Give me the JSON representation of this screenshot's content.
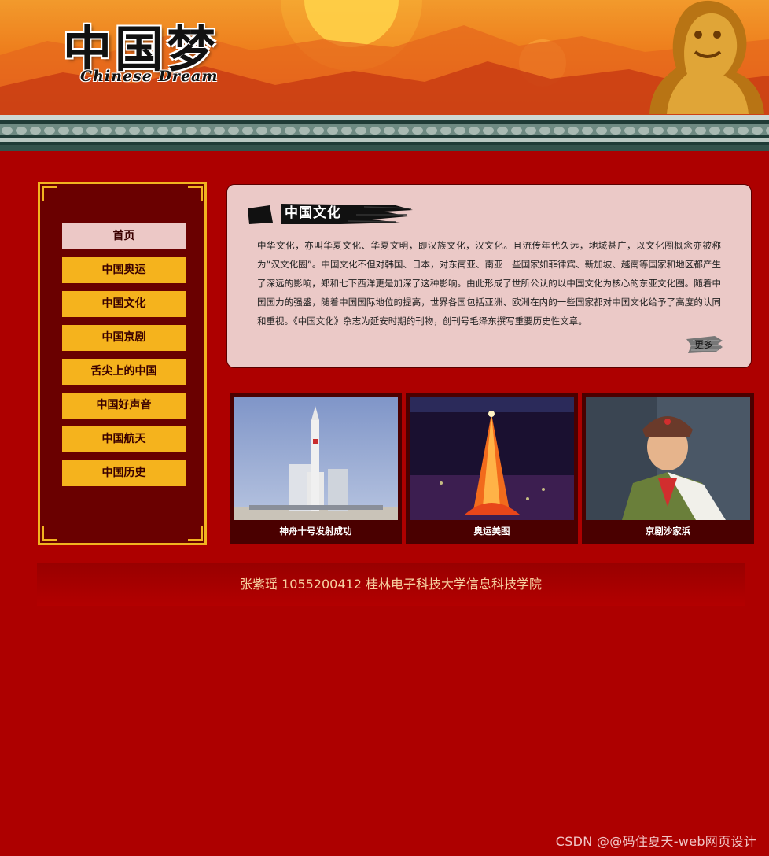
{
  "header": {
    "logo_cn": "中国梦",
    "logo_en": "Chinese Dream"
  },
  "sidebar": {
    "items": [
      {
        "label": "首页",
        "active": true
      },
      {
        "label": "中国奥运"
      },
      {
        "label": "中国文化"
      },
      {
        "label": "中国京剧"
      },
      {
        "label": "舌尖上的中国"
      },
      {
        "label": "中国好声音"
      },
      {
        "label": "中国航天"
      },
      {
        "label": "中国历史"
      }
    ]
  },
  "article": {
    "title": "中国文化",
    "body": "中华文化，亦叫华夏文化、华夏文明，即汉族文化，汉文化。且流传年代久远，地域甚广，以文化圈概念亦被称为“汉文化圈”。中国文化不但对韩国、日本，对东南亚、南亚一些国家如菲律宾、新加坡、越南等国家和地区都产生了深远的影响，郑和七下西洋更是加深了这种影响。由此形成了世所公认的以中国文化为核心的东亚文化圈。随着中国国力的强盛，随着中国国际地位的提高，世界各国包括亚洲、欧洲在内的一些国家都对中国文化给予了高度的认同和重视。《中国文化》杂志为延安时期的刊物，创刊号毛泽东撰写重要历史性文章。",
    "more_label": "更多"
  },
  "gallery": [
    {
      "caption": "神舟十号发射成功"
    },
    {
      "caption": "奥运美图"
    },
    {
      "caption": "京剧沙家浜"
    }
  ],
  "footer": {
    "text": "张紫瑶 1055200412 桂林电子科技大学信息科技学院"
  },
  "watermark": "CSDN @@码住夏天-web网页设计",
  "colors": {
    "page_bg": "#ad0000",
    "nav_item": "#f5b31d",
    "nav_active": "#ecc8c6",
    "frame_gold": "#f2b320",
    "card_bg": "#ebc9c7"
  }
}
